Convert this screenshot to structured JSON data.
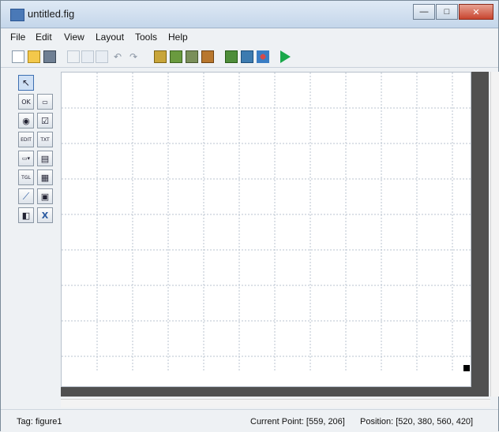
{
  "window": {
    "title": "untitled.fig"
  },
  "window_controls": {
    "minimize": "—",
    "maximize": "□",
    "close": "✕"
  },
  "menu": [
    "File",
    "Edit",
    "View",
    "Layout",
    "Tools",
    "Help"
  ],
  "toolbar_icons": [
    "new-icon",
    "open-icon",
    "save-icon",
    "cut-icon",
    "copy-icon",
    "paste-icon",
    "undo-icon",
    "redo-icon",
    "align-icon",
    "menu-editor-icon",
    "tab-order-icon",
    "toolbar-editor-icon",
    "mfile-editor-icon",
    "property-inspector-icon",
    "object-browser-icon",
    "run-icon"
  ],
  "palette": [
    {
      "name": "select-tool",
      "glyph": "↖"
    },
    {
      "name": "push-button-tool",
      "glyph": "OK"
    },
    {
      "name": "slider-tool",
      "glyph": "▭"
    },
    {
      "name": "radio-button-tool",
      "glyph": "◉"
    },
    {
      "name": "checkbox-tool",
      "glyph": "☑"
    },
    {
      "name": "edit-text-tool",
      "glyph": "EDIT"
    },
    {
      "name": "static-text-tool",
      "glyph": "TXT"
    },
    {
      "name": "popup-menu-tool",
      "glyph": "▭▾"
    },
    {
      "name": "listbox-tool",
      "glyph": "▤"
    },
    {
      "name": "toggle-button-tool",
      "glyph": "TGL"
    },
    {
      "name": "table-tool",
      "glyph": "▦"
    },
    {
      "name": "axes-tool",
      "glyph": "⟋"
    },
    {
      "name": "panel-tool",
      "glyph": "▣"
    },
    {
      "name": "button-group-tool",
      "glyph": "◧"
    },
    {
      "name": "activex-tool",
      "glyph": "X"
    }
  ],
  "status": {
    "tag": "Tag: figure1",
    "current_point": "Current Point: [559, 206]",
    "position": "Position: [520, 380, 560, 420]"
  },
  "colors": {
    "accent": "#4a79b7",
    "run": "#1aa84a",
    "canvas_shadow": "#505050"
  }
}
